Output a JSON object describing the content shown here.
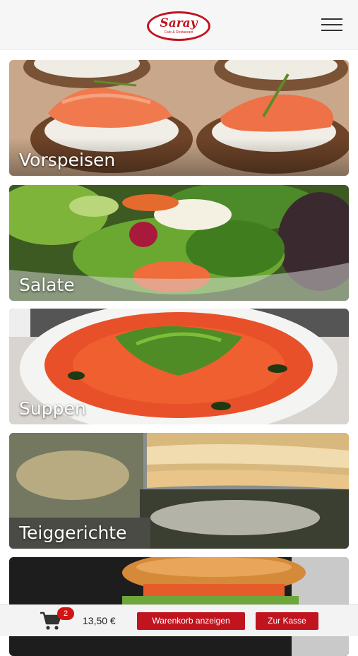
{
  "brand": {
    "name": "Saray",
    "tagline": "Cafe & Restaurant"
  },
  "categories": [
    {
      "label": "Vorspeisen"
    },
    {
      "label": "Salate"
    },
    {
      "label": "Suppen"
    },
    {
      "label": "Teiggerichte"
    },
    {
      "label": ""
    }
  ],
  "cart": {
    "badge_count": "2",
    "total": "13,50 €",
    "view_cart_label": "Warenkorb anzeigen",
    "checkout_label": "Zur Kasse"
  },
  "colors": {
    "brand_red": "#c0141f",
    "badge_red": "#d01515"
  }
}
